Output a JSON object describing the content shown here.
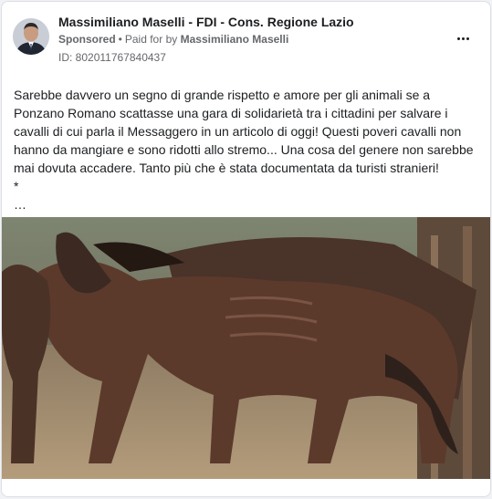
{
  "post": {
    "page_name": "Massimiliano Maselli - FDI - Cons. Regione Lazio",
    "sponsored_label": "Sponsored",
    "paid_for_prefix": "Paid for by",
    "paid_for_name": "Massimiliano Maselli",
    "ad_id": "ID: 802011767840437",
    "more_icon": "more-horizontal-icon",
    "text": "Sarebbe davvero un segno di grande rispetto e amore per gli animali se a Ponzano Romano scattasse una gara di solidarietà tra i cittadini per salvare i cavalli di cui parla il Messaggero in un articolo di oggi! Questi poveri cavalli non hanno da mangiare e sono ridotti allo stremo... Una cosa del genere non sarebbe mai dovuta accadere. Tanto più che è stata documentata da turisti stranieri!",
    "text_asterisk": "*",
    "text_ellipsis": "…",
    "image_subject": "emaciated horses in a paddock"
  },
  "colors": {
    "background": "#f0f2f5",
    "card": "#ffffff",
    "text_primary": "#1c1e21",
    "text_secondary": "#65676b"
  }
}
